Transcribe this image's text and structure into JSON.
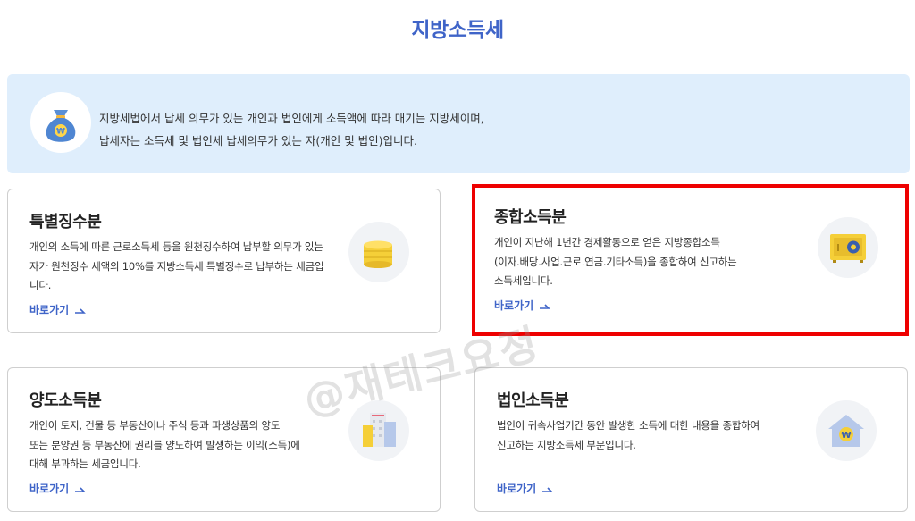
{
  "page": {
    "title": "지방소득세"
  },
  "info": {
    "line1": "지방세법에서 납세 의무가 있는 개인과 법인에게 소득액에 따라 매기는 지방세이며,",
    "line2": "납세자는 소득세 및 법인세 납세의무가 있는 자(개인 및 법인)입니다."
  },
  "cards": [
    {
      "title": "특별징수분",
      "desc1": "개인의 소득에 따른 근로소득세 등을 원천징수하여 납부할 의무가 있는",
      "desc2": "자가 원천징수 세액의 10%를 지방소득세 특별징수로 납부하는 세금입",
      "desc3": "니다.",
      "link": "바로가기"
    },
    {
      "title": "종합소득분",
      "desc1": "개인이 지난해 1년간 경제활동으로 얻은 지방종합소득",
      "desc2": "(이자.배당.사업.근로.연금.기타소득)을 종합하여 신고하는",
      "desc3": "소득세입니다.",
      "link": "바로가기"
    },
    {
      "title": "양도소득분",
      "desc1": "개인이 토지, 건물 등 부동산이나 주식 등과 파생상품의 양도",
      "desc2": "또는 분양권 등 부동산에 권리를 양도하여 발생하는 이익(소득)에",
      "desc3": "대해 부과하는 세금입니다.",
      "link": "바로가기"
    },
    {
      "title": "법인소득분",
      "desc1": "법인이 귀속사업기간 동안 발생한 소득에 대한 내용을 종합하여",
      "desc2": "신고하는 지방소득세 부문입니다.",
      "link": "바로가기"
    }
  ],
  "watermark": "@재테크요정",
  "icons": {
    "info": "money-bag-icon",
    "card0": "coin-stack-icon",
    "card1": "safe-icon",
    "card2": "buildings-icon",
    "card3": "house-won-icon",
    "link": "arrow-icon"
  },
  "colors": {
    "accent": "#3f64c8",
    "info_bg": "#dfeefc",
    "highlight": "#ee0000",
    "coin": "#f5cf38"
  }
}
